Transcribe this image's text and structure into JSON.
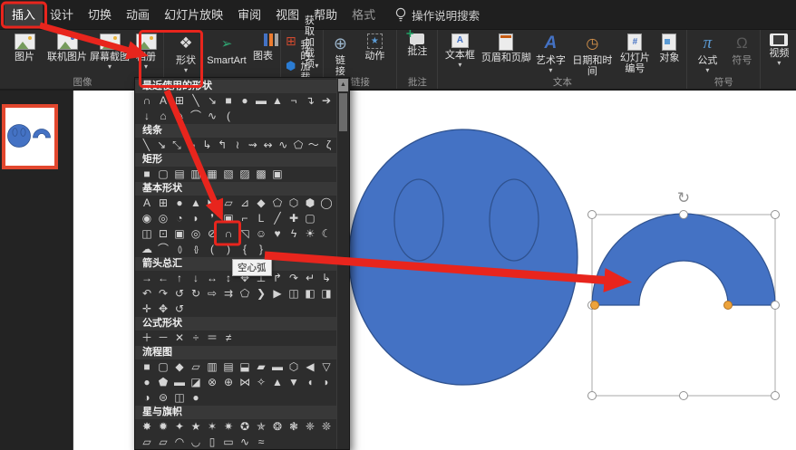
{
  "colors": {
    "shape-blue": "#4472C4",
    "shape-stroke": "#2F528F",
    "ann-red": "#E8251D",
    "thumb-orange": "#E2472E",
    "handle-orange": "#EDA33B",
    "canvas-white": "#FFFFFF",
    "ribbon-bg": "#2B2B2B",
    "tabbar-bg": "#1F1F1F",
    "menu-bg": "#2D2D2D",
    "menu-header-bg": "#383838",
    "panel-bg": "#232323"
  },
  "ui": {
    "caret": "▾",
    "scroll_up_glyph": "▲",
    "rotate_glyph": "↻"
  },
  "tabs": {
    "items": [
      {
        "id": "insert",
        "label": "插入",
        "selected": true,
        "annotated": true
      },
      {
        "id": "design",
        "label": "设计"
      },
      {
        "id": "transitions",
        "label": "切换"
      },
      {
        "id": "animations",
        "label": "动画"
      },
      {
        "id": "slideshow",
        "label": "幻灯片放映"
      },
      {
        "id": "review",
        "label": "审阅"
      },
      {
        "id": "view",
        "label": "视图"
      },
      {
        "id": "help",
        "label": "帮助"
      },
      {
        "id": "format",
        "label": "格式",
        "dimmed": true
      }
    ],
    "search_label": "操作说明搜索"
  },
  "ribbon": {
    "groups": [
      {
        "id": "images",
        "label": "图像",
        "buttons": [
          {
            "id": "pictures",
            "label": "图片",
            "icon": "picture-icon"
          },
          {
            "id": "online-pictures",
            "label": "联机图片",
            "icon": "online-picture-icon"
          },
          {
            "id": "screenshot",
            "label": "屏幕截图",
            "icon": "screenshot-icon",
            "caret": true
          },
          {
            "id": "photo-album",
            "label": "相册",
            "icon": "photo-album-icon",
            "caret": true
          }
        ]
      },
      {
        "id": "illustrations",
        "label": "",
        "buttons": [
          {
            "id": "shapes",
            "label": "形状",
            "icon": "shapes-icon",
            "caret": true
          },
          {
            "id": "smartart",
            "label": "SmartArt",
            "icon": "smartart-icon"
          },
          {
            "id": "chart",
            "label": "图表",
            "icon": "chart-icon"
          }
        ]
      },
      {
        "id": "add-ins",
        "label": "",
        "stacked": true,
        "buttons": [
          {
            "id": "get-add-ins",
            "label": "获取加载项",
            "icon": "get-add-ins-icon"
          },
          {
            "id": "my-add-ins",
            "label": "我的加载项",
            "icon": "my-add-ins-icon",
            "caret": true
          }
        ]
      },
      {
        "id": "links",
        "label": "链接",
        "buttons": [
          {
            "id": "link",
            "label": "链接",
            "lines": [
              "链",
              "接"
            ],
            "icon": "link-icon"
          },
          {
            "id": "action",
            "label": "动作",
            "icon": "action-icon"
          }
        ]
      },
      {
        "id": "comments",
        "label": "批注",
        "buttons": [
          {
            "id": "comment",
            "label": "批注",
            "icon": "comment-icon"
          }
        ]
      },
      {
        "id": "text",
        "label": "文本",
        "buttons": [
          {
            "id": "text-box",
            "label": "文本框",
            "icon": "text-box-icon",
            "caret": true
          },
          {
            "id": "header-footer",
            "label": "页眉和页脚",
            "icon": "header-footer-icon"
          },
          {
            "id": "wordart",
            "label": "艺术字",
            "icon": "wordart-icon",
            "caret": true
          },
          {
            "id": "date-time",
            "label": "日期和时间",
            "icon": "date-time-icon"
          },
          {
            "id": "slide-number",
            "label": "幻灯片编号",
            "lines": [
              "幻灯片",
              "编号"
            ],
            "icon": "slide-number-icon"
          },
          {
            "id": "object",
            "label": "对象",
            "icon": "object-icon"
          }
        ]
      },
      {
        "id": "symbols",
        "label": "符号",
        "buttons": [
          {
            "id": "equation",
            "label": "公式",
            "icon": "equation-icon",
            "caret": true
          },
          {
            "id": "symbol",
            "label": "符号",
            "icon": "symbol-icon",
            "dimmed": true
          }
        ]
      },
      {
        "id": "media",
        "label": "",
        "buttons": [
          {
            "id": "video",
            "label": "视频",
            "icon": "video-icon",
            "caret": true
          }
        ]
      }
    ]
  },
  "icon_glyphs": {
    "shapes-icon": "❖",
    "smartart-icon": "➢",
    "get-add-ins-icon": "⊞",
    "my-add-ins-icon": "⬢",
    "link-icon": "⊕",
    "action-icon": "★",
    "text-box-icon": "A",
    "wordart-icon": "A",
    "date-time-icon": "◷",
    "slide-number-icon": "#",
    "equation-icon": "π",
    "symbol-icon": "Ω"
  },
  "shapes_menu": {
    "tooltip": "空心弧",
    "sections": [
      {
        "id": "recent",
        "title": "最近使用的形状",
        "rows": [
          [
            [
              "∩",
              "block-arc"
            ],
            [
              "A",
              "text-box"
            ],
            [
              "⊞",
              "vertical-text-box"
            ],
            [
              "╲",
              "line"
            ],
            [
              "↘",
              "line-arrow"
            ],
            [
              "■",
              "rectangle"
            ],
            [
              "●",
              "oval"
            ],
            [
              "▬",
              "rounded-rectangle"
            ],
            [
              "▲",
              "isosceles-triangle"
            ],
            [
              "¬",
              "elbow-connector"
            ],
            [
              "↴",
              "elbow-arrow-connector"
            ],
            [
              "➔",
              "right-arrow"
            ]
          ],
          [
            [
              "↓",
              "down-arrow"
            ],
            [
              "⌂",
              "freeform"
            ],
            [
              "✎",
              "scribble"
            ],
            [
              "⌒",
              "arc"
            ],
            [
              "∿",
              "curve"
            ],
            [
              "(",
              "left-brace"
            ]
          ]
        ]
      },
      {
        "id": "lines",
        "title": "线条",
        "rows": [
          [
            [
              "╲",
              "line"
            ],
            [
              "↘",
              "line-arrow"
            ],
            [
              "⤡",
              "line-double-arrow"
            ],
            [
              "¬",
              "elbow-connector"
            ],
            [
              "↳",
              "elbow-arrow-connector"
            ],
            [
              "↰",
              "elbow-double-arrow-connector"
            ],
            [
              "≀",
              "curved-connector"
            ],
            [
              "⇝",
              "curved-arrow-connector"
            ],
            [
              "↭",
              "curved-double-arrow-connector"
            ],
            [
              "∿",
              "curve"
            ],
            [
              "⬠",
              "freeform-shape"
            ],
            [
              "〜",
              "freeform-scribble"
            ],
            [
              "ζ",
              "scribble"
            ]
          ]
        ]
      },
      {
        "id": "rectangles",
        "title": "矩形",
        "rows": [
          [
            [
              "■",
              "rectangle"
            ],
            [
              "▢",
              "rounded-rectangle"
            ],
            [
              "▤",
              "snip-single-corner-rectangle"
            ],
            [
              "▥",
              "snip-same-side-corner-rectangle"
            ],
            [
              "▦",
              "snip-diagonal-corner-rectangle"
            ],
            [
              "▧",
              "snip-round-single-corner-rectangle"
            ],
            [
              "▨",
              "round-single-corner-rectangle"
            ],
            [
              "▩",
              "round-same-side-corner-rectangle"
            ],
            [
              "▣",
              "round-diagonal-corner-rectangle"
            ]
          ]
        ]
      },
      {
        "id": "basic-shapes",
        "title": "基本形状",
        "rows": [
          [
            [
              "A",
              "text-box"
            ],
            [
              "⊞",
              "vertical-text-box"
            ],
            [
              "●",
              "oval"
            ],
            [
              "▲",
              "isosceles-triangle"
            ],
            [
              "◣",
              "right-triangle"
            ],
            [
              "▱",
              "parallelogram"
            ],
            [
              "⊿",
              "trapezoid"
            ],
            [
              "◆",
              "diamond"
            ],
            [
              "⬠",
              "regular-pentagon"
            ],
            [
              "⬡",
              "hexagon"
            ],
            [
              "⬢",
              "heptagon"
            ],
            [
              "◯",
              "octagon"
            ]
          ],
          [
            [
              "◉",
              "decagon"
            ],
            [
              "◎",
              "dodecagon"
            ],
            [
              "◔",
              "pie"
            ],
            [
              "◗",
              "chord"
            ],
            [
              "❜",
              "teardrop"
            ],
            [
              "▣",
              "frame"
            ],
            [
              "⌐",
              "half-frame"
            ],
            [
              "L",
              "l-shape"
            ],
            [
              "╱",
              "diagonal-stripe"
            ],
            [
              "✚",
              "cross"
            ],
            [
              "▢",
              "plaque"
            ]
          ],
          [
            [
              "◫",
              "can"
            ],
            [
              "⊡",
              "cube"
            ],
            [
              "▣",
              "bevel"
            ],
            [
              "◎",
              "donut"
            ],
            [
              "⊘",
              "no-symbol"
            ],
            [
              "∩",
              "block-arc",
              "hl"
            ],
            [
              "◹",
              "folded-corner"
            ],
            [
              "☺",
              "smiley-face"
            ],
            [
              "♥",
              "heart"
            ],
            [
              "ϟ",
              "lightning-bolt"
            ],
            [
              "☀",
              "sun"
            ],
            [
              "☾",
              "moon"
            ]
          ],
          [
            [
              "☁",
              "cloud"
            ],
            [
              "⌒",
              "arc"
            ],
            [
              "()",
              "double-bracket"
            ],
            [
              "{}",
              "double-brace"
            ],
            [
              "(",
              "left-bracket"
            ],
            [
              ")",
              "right-bracket"
            ],
            [
              "{",
              "left-brace"
            ],
            [
              "}",
              "right-brace"
            ]
          ]
        ]
      },
      {
        "id": "block-arrows",
        "title": "箭头总汇",
        "rows": [
          [
            [
              "→",
              "right-arrow"
            ],
            [
              "←",
              "left-arrow"
            ],
            [
              "↑",
              "up-arrow"
            ],
            [
              "↓",
              "down-arrow"
            ],
            [
              "↔",
              "left-right-arrow"
            ],
            [
              "↕",
              "up-down-arrow"
            ],
            [
              "✥",
              "quad-arrow"
            ],
            [
              "⊥",
              "left-right-up-arrow"
            ],
            [
              "↱",
              "bent-arrow"
            ],
            [
              "↷",
              "u-turn-arrow"
            ],
            [
              "↵",
              "bent-up-arrow"
            ],
            [
              "↳",
              "curved-right-arrow"
            ]
          ],
          [
            [
              "↶",
              "curved-left-arrow"
            ],
            [
              "↷",
              "curved-down-arrow"
            ],
            [
              "↺",
              "curved-up-arrow"
            ],
            [
              "↻",
              "circular-arrow"
            ],
            [
              "⇨",
              "striped-right-arrow"
            ],
            [
              "⇉",
              "notched-right-arrow"
            ],
            [
              "⬠",
              "pentagon-arrow"
            ],
            [
              "❯",
              "chevron-arrow"
            ],
            [
              "▶",
              "right-arrow-callout"
            ],
            [
              "◫",
              "down-arrow-callout"
            ],
            [
              "◧",
              "left-arrow-callout"
            ],
            [
              "◨",
              "up-arrow-callout"
            ]
          ],
          [
            [
              "✛",
              "quad-arrow-callout"
            ],
            [
              "✥",
              "left-right-arrow-callout"
            ],
            [
              "↺",
              "circular-arrow-2"
            ]
          ]
        ]
      },
      {
        "id": "equation-shapes",
        "title": "公式形状",
        "rows": [
          [
            [
              "＋",
              "plus-sign"
            ],
            [
              "－",
              "minus-sign"
            ],
            [
              "✕",
              "multiplication-sign"
            ],
            [
              "÷",
              "division-sign"
            ],
            [
              "＝",
              "equal-sign"
            ],
            [
              "≠",
              "not-equal-sign"
            ]
          ]
        ]
      },
      {
        "id": "flowchart",
        "title": "流程图",
        "rows": [
          [
            [
              "■",
              "process"
            ],
            [
              "▢",
              "alternate-process"
            ],
            [
              "◆",
              "decision"
            ],
            [
              "▱",
              "data"
            ],
            [
              "▥",
              "predefined-process"
            ],
            [
              "▤",
              "internal-storage"
            ],
            [
              "⬓",
              "document"
            ],
            [
              "▰",
              "multidocument"
            ],
            [
              "▬",
              "terminator"
            ],
            [
              "⬡",
              "preparation"
            ],
            [
              "◀",
              "manual-input"
            ],
            [
              "▽",
              "manual-operation"
            ]
          ],
          [
            [
              "●",
              "connector"
            ],
            [
              "⬟",
              "off-page-connector"
            ],
            [
              "▬",
              "card"
            ],
            [
              "◪",
              "punched-tape"
            ],
            [
              "⊗",
              "summing-junction"
            ],
            [
              "⊕",
              "or"
            ],
            [
              "⋈",
              "collate"
            ],
            [
              "✧",
              "sort"
            ],
            [
              "▲",
              "extract"
            ],
            [
              "▼",
              "merge"
            ],
            [
              "◖",
              "stored-data"
            ],
            [
              "◗",
              "delay"
            ]
          ],
          [
            [
              "◑",
              "sequential-access-storage"
            ],
            [
              "⊜",
              "magnetic-disk"
            ],
            [
              "◫",
              "direct-access-storage"
            ],
            [
              "●",
              "display"
            ]
          ]
        ]
      },
      {
        "id": "stars-banners",
        "title": "星与旗帜",
        "rows": [
          [
            [
              "✸",
              "explosion-1"
            ],
            [
              "✹",
              "explosion-2"
            ],
            [
              "✦",
              "star-4-point"
            ],
            [
              "★",
              "star-5-point"
            ],
            [
              "✶",
              "star-6-point"
            ],
            [
              "✷",
              "star-7-point"
            ],
            [
              "✪",
              "star-8-point"
            ],
            [
              "✯",
              "star-10-point"
            ],
            [
              "❂",
              "star-12-point"
            ],
            [
              "❃",
              "star-16-point"
            ],
            [
              "❈",
              "star-24-point"
            ],
            [
              "❊",
              "star-32-point"
            ]
          ],
          [
            [
              "▱",
              "ribbon-tilted-up"
            ],
            [
              "▱",
              "ribbon-tilted-down"
            ],
            [
              "◠",
              "curved-ribbon-up"
            ],
            [
              "◡",
              "curved-ribbon-down"
            ],
            [
              "▯",
              "vertical-scroll"
            ],
            [
              "▭",
              "horizontal-scroll"
            ],
            [
              "∿",
              "wave"
            ],
            [
              "≈",
              "double-wave"
            ]
          ]
        ]
      }
    ]
  },
  "slide": {
    "number": "1",
    "shapes": [
      {
        "name": "oval-with-eyes"
      },
      {
        "name": "block-arc",
        "selected": true
      }
    ]
  }
}
